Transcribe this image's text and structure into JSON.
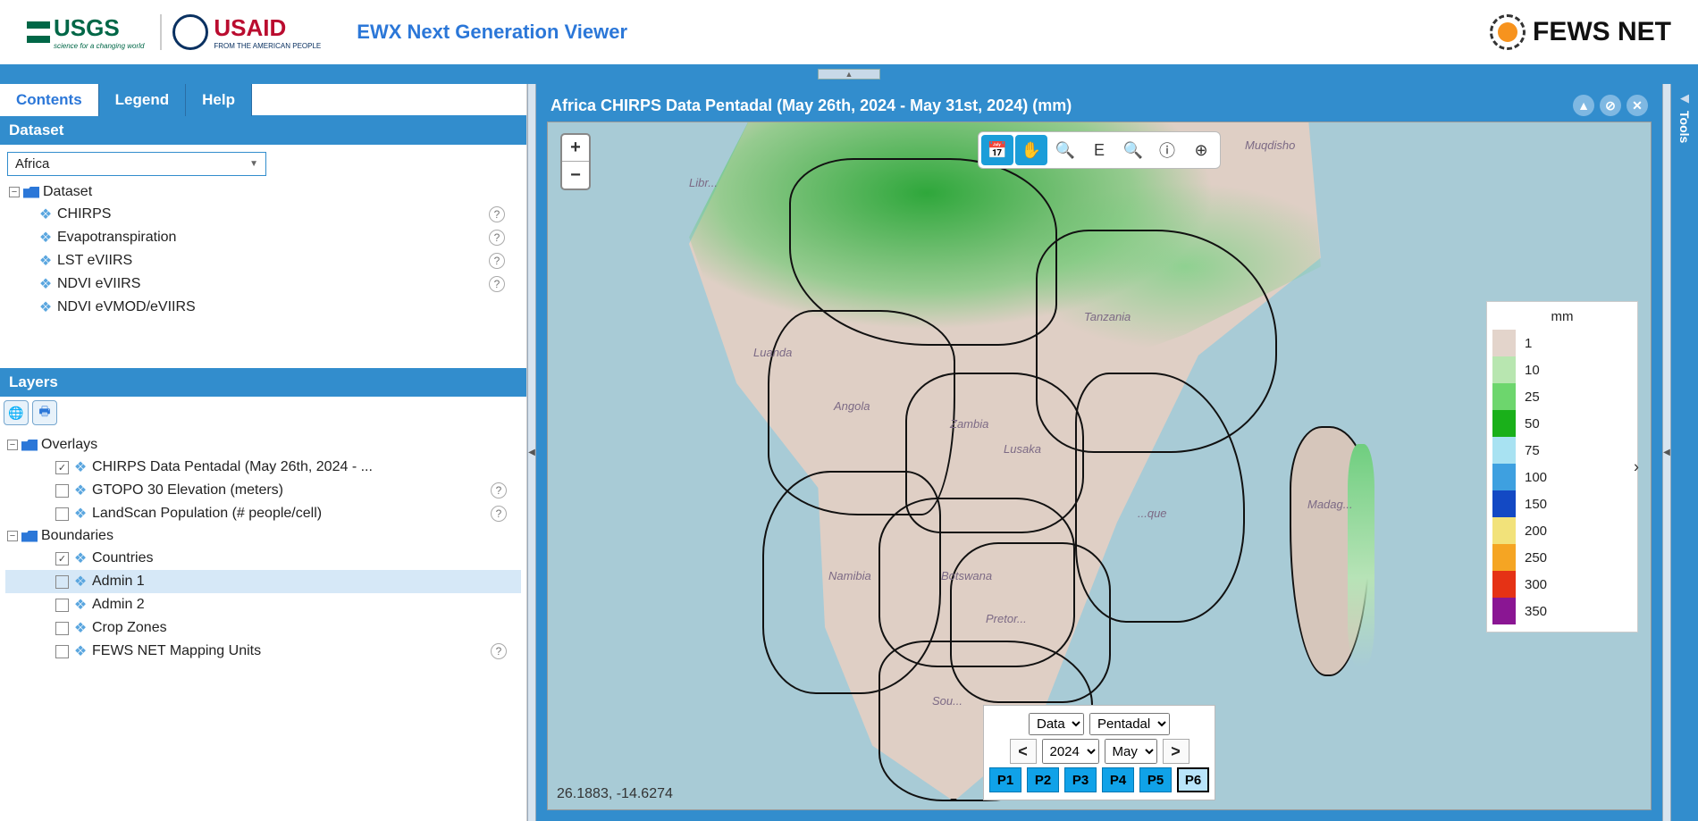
{
  "header": {
    "usgs": "USGS",
    "usgs_sub": "science for a changing world",
    "usaid": "USAID",
    "usaid_sub": "FROM THE AMERICAN PEOPLE",
    "app_title": "EWX Next Generation Viewer",
    "fewsnet": "FEWS NET"
  },
  "tabs": {
    "contents": "Contents",
    "legend": "Legend",
    "help": "Help"
  },
  "dataset_panel": {
    "title": "Dataset",
    "combo_value": "Africa",
    "root": "Dataset",
    "items": [
      {
        "label": "CHIRPS",
        "help": true
      },
      {
        "label": "Evapotranspiration",
        "help": true
      },
      {
        "label": "LST eVIIRS",
        "help": true
      },
      {
        "label": "NDVI eVIIRS",
        "help": true
      },
      {
        "label": "NDVI eVMOD/eVIIRS",
        "help": false
      }
    ]
  },
  "layers_panel": {
    "title": "Layers",
    "overlays_label": "Overlays",
    "overlays": [
      {
        "label": "CHIRPS Data Pentadal (May 26th, 2024 - ...",
        "checked": true,
        "help": false
      },
      {
        "label": "GTOPO 30 Elevation (meters)",
        "checked": false,
        "help": true
      },
      {
        "label": "LandScan Population (# people/cell)",
        "checked": false,
        "help": true
      }
    ],
    "boundaries_label": "Boundaries",
    "boundaries": [
      {
        "label": "Countries",
        "checked": true,
        "help": false
      },
      {
        "label": "Admin 1",
        "checked": false,
        "help": false,
        "hover": true
      },
      {
        "label": "Admin 2",
        "checked": false,
        "help": false
      },
      {
        "label": "Crop Zones",
        "checked": false,
        "help": false
      },
      {
        "label": "FEWS NET Mapping Units",
        "checked": false,
        "help": true
      }
    ]
  },
  "map": {
    "title": "Africa CHIRPS Data Pentadal (May 26th, 2024 - May 31st, 2024) (mm)",
    "coords": "26.1883, -14.6274",
    "cities": {
      "libreville": "Libr...",
      "luanda": "Luanda",
      "angola": "Angola",
      "zambia": "Zambia",
      "lusaka": "Lusaka",
      "namibia": "Namibia",
      "botswana": "Botswana",
      "pretoria": "Pretor...",
      "south": "Sou...",
      "tanzania": "Tanzania",
      "muqdisho": "Muqdisho",
      "madagascar": "Madag...",
      "mozambique": "...que"
    },
    "toolbar": {
      "time": "time",
      "pan": "pan",
      "zoom_in": "zoom-in",
      "extent": "E",
      "zoom_out": "zoom-out",
      "identify": "identify",
      "target": "target"
    }
  },
  "legend": {
    "unit": "mm",
    "stops": [
      {
        "value": "1",
        "color": "#e3d4cb"
      },
      {
        "value": "10",
        "color": "#b8e6b0"
      },
      {
        "value": "25",
        "color": "#6dd66d"
      },
      {
        "value": "50",
        "color": "#1ab01a"
      },
      {
        "value": "75",
        "color": "#a8e2f2"
      },
      {
        "value": "100",
        "color": "#3ea0e0"
      },
      {
        "value": "150",
        "color": "#1349c4"
      },
      {
        "value": "200",
        "color": "#f2e27a"
      },
      {
        "value": "250",
        "color": "#f5a523"
      },
      {
        "value": "300",
        "color": "#e53215"
      },
      {
        "value": "350",
        "color": "#8a1693"
      }
    ]
  },
  "time": {
    "type_select": "Data",
    "interval_select": "Pentadal",
    "year": "2024",
    "month": "May",
    "pentads": [
      "P1",
      "P2",
      "P3",
      "P4",
      "P5",
      "P6"
    ],
    "selected_pentad": "P6"
  },
  "tools": {
    "label": "Tools"
  }
}
